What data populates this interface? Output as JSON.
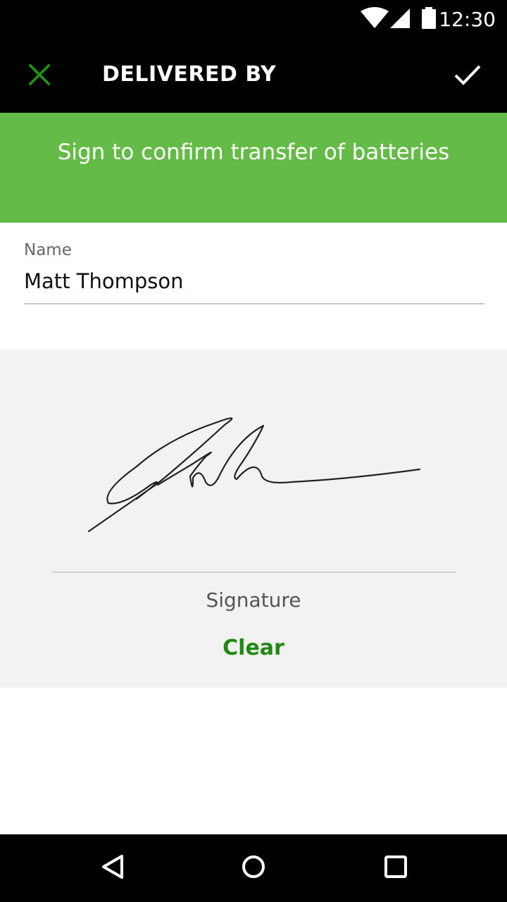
{
  "status_bar": {
    "time": "12:30",
    "icons": [
      "wifi-icon",
      "cell-signal-icon",
      "battery-icon"
    ]
  },
  "app_bar": {
    "title": "DELIVERED BY",
    "close_icon": "close-icon",
    "confirm_icon": "check-icon",
    "close_color": "#1e9a12"
  },
  "banner": {
    "text": "Sign to confirm transfer of batteries",
    "color": "#65bb47"
  },
  "name_field": {
    "label": "Name",
    "value": "Matt Thompson"
  },
  "signature": {
    "label": "Signature",
    "clear_label": "Clear",
    "accent_color": "#1e8a10"
  },
  "nav_bar": {
    "icons": [
      "back-icon",
      "home-icon",
      "recents-icon"
    ]
  }
}
